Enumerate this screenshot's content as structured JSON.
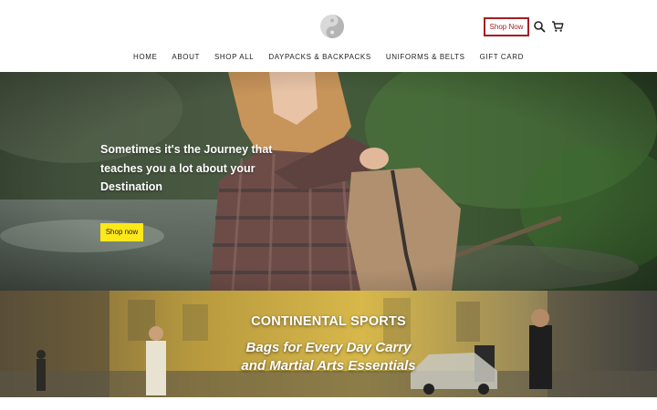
{
  "header": {
    "shop_now_label": "Shop Now",
    "accent_color": "#a31e22"
  },
  "nav": {
    "items": [
      {
        "label": "HOME"
      },
      {
        "label": "ABOUT"
      },
      {
        "label": "SHOP ALL"
      },
      {
        "label": "DAYPACKS & BACKPACKS"
      },
      {
        "label": "UNIFORMS & BELTS"
      },
      {
        "label": "GIFT CARD"
      }
    ]
  },
  "hero": {
    "headline_lines": [
      "Sometimes it's the Journey that",
      "teaches you a lot about your",
      "Destination"
    ],
    "button_label": "Shop now",
    "button_color": "#ffe81a"
  },
  "banner": {
    "title": "CONTINENTAL SPORTS",
    "subtitle_line1": "Bags for Every Day Carry",
    "subtitle_line2": "and Martial Arts Essentials"
  },
  "icons": [
    "yin-yang-logo",
    "search-icon",
    "cart-icon"
  ]
}
